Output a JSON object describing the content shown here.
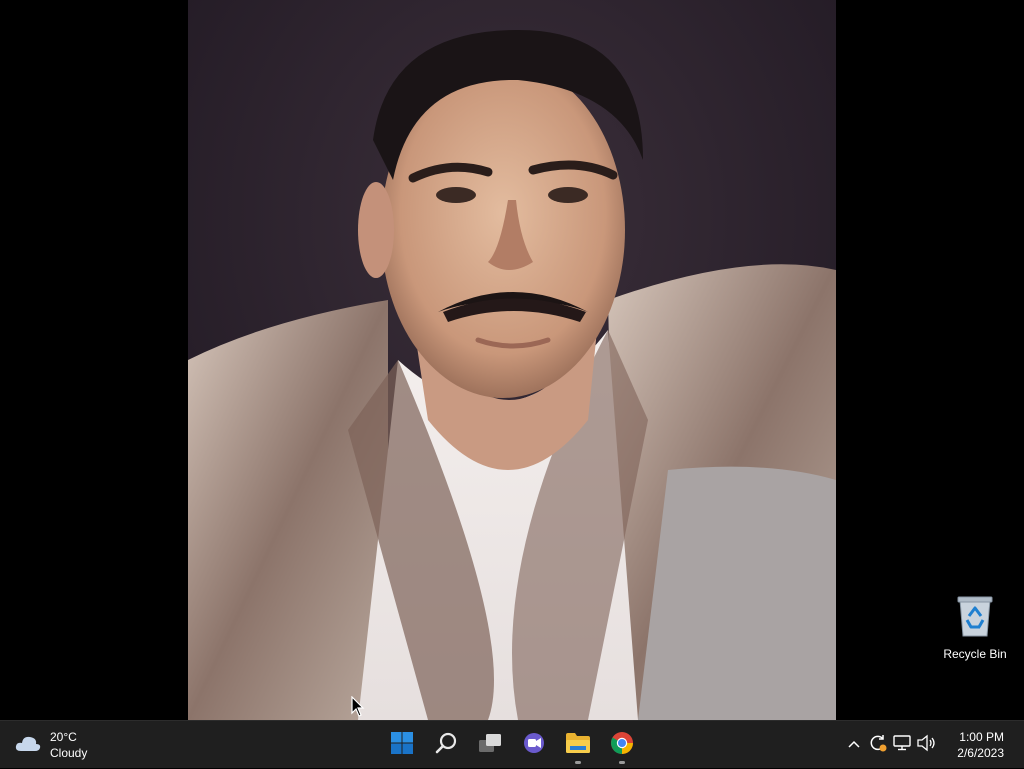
{
  "desktop": {
    "icons": [
      {
        "label": "Recycle Bin",
        "icon": "recycle-bin-icon"
      }
    ]
  },
  "taskbar": {
    "weather": {
      "temperature": "20°C",
      "condition": "Cloudy",
      "icon": "cloudy-weather-icon"
    },
    "apps": [
      {
        "name": "Start",
        "icon": "windows-start-icon",
        "running": false
      },
      {
        "name": "Search",
        "icon": "search-icon",
        "running": false
      },
      {
        "name": "Task View",
        "icon": "task-view-icon",
        "running": false
      },
      {
        "name": "Chat",
        "icon": "chat-icon",
        "running": false
      },
      {
        "name": "File Explorer",
        "icon": "folder-icon",
        "running": true
      },
      {
        "name": "Google Chrome",
        "icon": "chrome-icon",
        "running": true
      }
    ],
    "tray": {
      "icons": [
        "chevron-up-icon",
        "update-icon",
        "network-icon",
        "volume-icon"
      ]
    },
    "clock": {
      "time": "1:00 PM",
      "date": "2/6/2023"
    }
  },
  "colors": {
    "taskbar_bg": "#1f1f1f",
    "start_blue": "#0078d4",
    "accent_blue": "#3a8ee6"
  }
}
